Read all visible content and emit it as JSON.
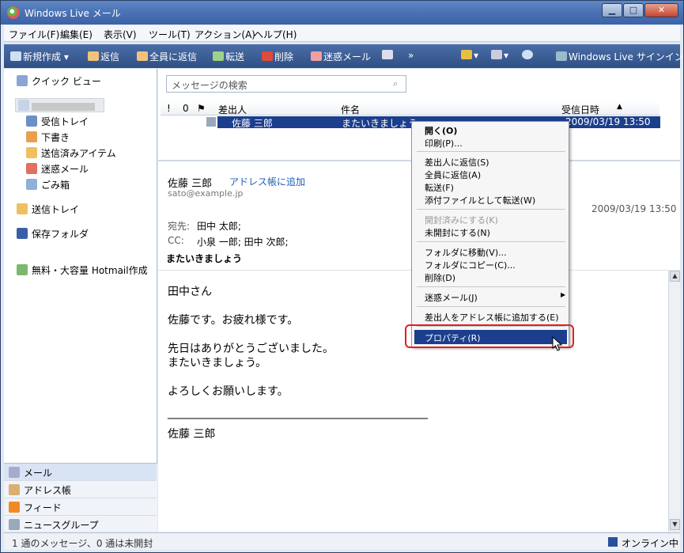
{
  "window": {
    "title": "Windows Live メール"
  },
  "menubar": [
    "ファイル(F)",
    "編集(E)",
    "表示(V)",
    "ツール(T)",
    "アクション(A)",
    "ヘルプ(H)"
  ],
  "toolbar": {
    "new": "新規作成",
    "reply": "返信",
    "reply_all": "全員に返信",
    "forward": "転送",
    "delete": "削除",
    "junk": "迷惑メール",
    "more": "»",
    "signin": "Windows Live サインイン"
  },
  "sidebar": {
    "quick_view": "クイック ビュー",
    "inbox": "受信トレイ",
    "drafts": "下書き",
    "sent": "送信済みアイテム",
    "junk": "迷惑メール",
    "trash": "ごみ箱",
    "outbox": "送信トレイ",
    "saved": "保存フォルダ",
    "hotmail": "無料・大容量 Hotmail作成"
  },
  "bottom_nav": [
    "メール",
    "アドレス帳",
    "フィード",
    "ニュースグループ"
  ],
  "search": {
    "placeholder": "メッセージの検索"
  },
  "columns": {
    "from": "差出人",
    "subject": "件名",
    "received": "受信日時"
  },
  "message_row": {
    "from": "佐藤 三郎",
    "subject": "またいきましょう",
    "date": "2009/03/19 13:50"
  },
  "preview": {
    "sender": "佐藤 三郎",
    "add_contact": "アドレス帳に追加",
    "email": "sato@example.jp",
    "date": "2009/03/19 13:50",
    "to_label": "宛先:",
    "to": "田中 太郎;",
    "cc_label": "CC:",
    "cc": "小泉 一郎; 田中 次郎;",
    "subject": "またいきましょう"
  },
  "body": {
    "line1": "田中さん",
    "line2": "佐藤です。お疲れ様です。",
    "line3": "先日はありがとうございました。",
    "line4": "またいきましょう。",
    "line5": "よろしくお願いします。",
    "line6": "_______________________________________________",
    "line7": "佐藤 三郎"
  },
  "context_menu": {
    "open": "開く(O)",
    "print": "印刷(P)...",
    "reply_sender": "差出人に返信(S)",
    "reply_all": "全員に返信(A)",
    "forward": "転送(F)",
    "forward_attach": "添付ファイルとして転送(W)",
    "mark_read": "開封済みにする(K)",
    "mark_unread": "未開封にする(N)",
    "move": "フォルダに移動(V)...",
    "copy": "フォルダにコピー(C)...",
    "delete": "削除(D)",
    "junk": "迷惑メール(J)",
    "add_sender": "差出人をアドレス帳に追加する(E)",
    "properties": "プロパティ(R)"
  },
  "status": {
    "messages": "1 通のメッセージ、0 通は未開封",
    "online": "オンライン中"
  }
}
